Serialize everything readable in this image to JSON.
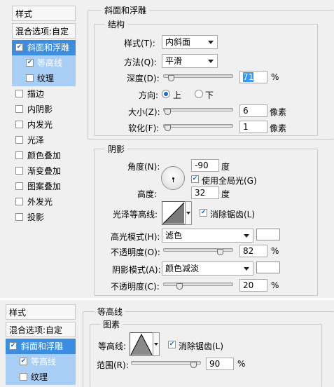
{
  "top": {
    "sidebar": {
      "header": "样式",
      "blend": "混合选项:自定",
      "items": [
        {
          "label": "斜面和浮雕",
          "checked": true
        },
        {
          "label": "等高线",
          "checked": true
        },
        {
          "label": "纹理",
          "checked": false
        },
        {
          "label": "描边",
          "checked": false
        },
        {
          "label": "内阴影",
          "checked": false
        },
        {
          "label": "内发光",
          "checked": false
        },
        {
          "label": "光泽",
          "checked": false
        },
        {
          "label": "颜色叠加",
          "checked": false
        },
        {
          "label": "渐变叠加",
          "checked": false
        },
        {
          "label": "图案叠加",
          "checked": false
        },
        {
          "label": "外发光",
          "checked": false
        },
        {
          "label": "投影",
          "checked": false
        }
      ]
    },
    "bevel": {
      "title": "斜面和浮雕",
      "structure": "结构",
      "style_label": "样式(T):",
      "style_value": "内斜面",
      "method_label": "方法(Q):",
      "method_value": "平滑",
      "depth_label": "深度(D):",
      "depth_value": "71",
      "depth_unit": "%",
      "depth_level": 0.07,
      "direction_label": "方向:",
      "dir_up": "上",
      "dir_down": "下",
      "size_label": "大小(Z):",
      "size_value": "6",
      "size_unit": "像素",
      "size_level": 0.02,
      "soften_label": "软化(F):",
      "soften_value": "1",
      "soften_unit": "像素",
      "soften_level": 0.02
    },
    "shading": {
      "title": "阴影",
      "angle_label": "角度(N):",
      "angle_value": "-90",
      "angle_unit": "度",
      "global_light": "使用全局光(G)",
      "altitude_label": "高度:",
      "altitude_value": "32",
      "altitude_unit": "度",
      "gloss_label": "光泽等高线:",
      "antialias": "消除锯齿(L)",
      "highlight_label": "高光模式(H):",
      "highlight_value": "滤色",
      "highlight_color": "#ffffff",
      "hl_opacity_label": "不透明度(O):",
      "hl_opacity_value": "82",
      "hl_opacity_level": 0.82,
      "shadow_label": "阴影模式(A):",
      "shadow_value": "颜色减淡",
      "shadow_color": "#ffffff",
      "sh_opacity_label": "不透明度(C):",
      "sh_opacity_value": "20",
      "sh_opacity_level": 0.2,
      "percent": "%"
    }
  },
  "bottom": {
    "sidebar": {
      "header": "样式",
      "blend": "混合选项:自定",
      "items": [
        {
          "label": "斜面和浮雕",
          "checked": true
        },
        {
          "label": "等高线",
          "checked": true
        },
        {
          "label": "纹理",
          "checked": false
        }
      ]
    },
    "contour": {
      "title": "等高线",
      "group": "图素",
      "contour_label": "等高线:",
      "antialias": "消除锯齿(L)",
      "range_label": "范围(R):",
      "range_value": "90",
      "range_unit": "%",
      "range_level": 0.9
    }
  }
}
